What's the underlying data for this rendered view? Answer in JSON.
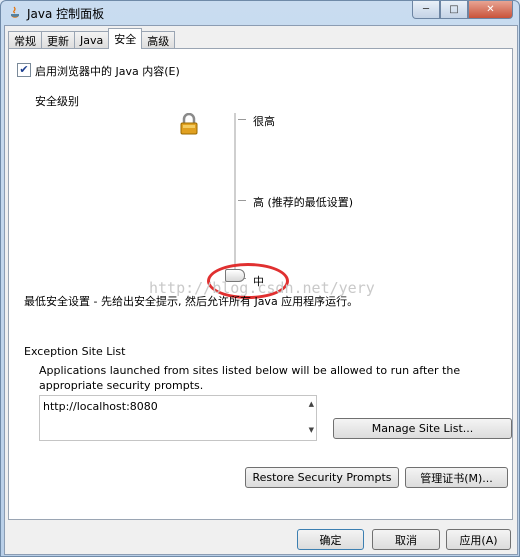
{
  "window": {
    "title": "Java 控制面板"
  },
  "tabs": [
    {
      "label": "常规"
    },
    {
      "label": "更新"
    },
    {
      "label": "Java"
    },
    {
      "label": "安全"
    },
    {
      "label": "高级"
    }
  ],
  "security": {
    "enable_label": "启用浏览器中的 Java 内容(E)",
    "enable_checked": true,
    "level_title": "安全级别",
    "levels": [
      {
        "label": "很高"
      },
      {
        "label": "高 (推荐的最低设置)"
      },
      {
        "label": "中"
      }
    ],
    "selected_level": "中",
    "description": "最低安全设置 - 先给出安全提示, 然后允许所有 Java 应用程序运行。"
  },
  "watermark": "http://blog.csdn.net/yery",
  "exception_list": {
    "title": "Exception Site List",
    "description": "Applications launched from sites listed below will be allowed to run after the appropriate security prompts.",
    "sites": [
      "http://localhost:8080"
    ],
    "manage_label": "Manage Site List..."
  },
  "buttons": {
    "restore": "Restore Security Prompts",
    "certificates": "管理证书(M)...",
    "ok": "确定",
    "cancel": "取消",
    "apply": "应用(A)"
  }
}
